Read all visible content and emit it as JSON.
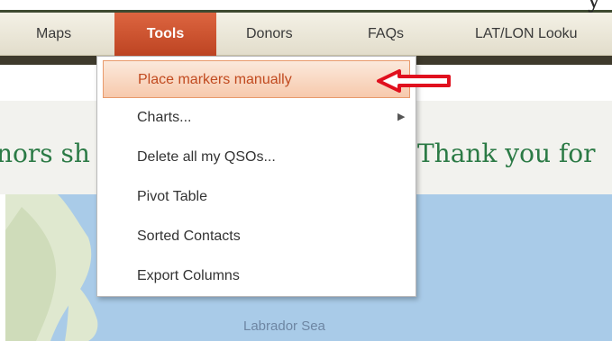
{
  "nav": {
    "items": [
      "Maps",
      "Tools",
      "Donors",
      "FAQs",
      "LAT/LON Looku"
    ],
    "active": "Tools"
  },
  "tools_menu": {
    "items": [
      {
        "label": "Place markers manually",
        "highlighted": true
      },
      {
        "label": "Charts...",
        "has_submenu": true
      },
      {
        "label": "Delete all my QSOs..."
      },
      {
        "label": "Pivot Table"
      },
      {
        "label": "Sorted Contacts"
      },
      {
        "label": "Export Columns"
      }
    ],
    "submenu_glyph": "▶"
  },
  "banner": {
    "left_fragment": "nors sh",
    "right_fragment": "Thank you for"
  },
  "map": {
    "label": "Labrador Sea"
  },
  "colors": {
    "accent": "#c9502c",
    "banner_text": "#2b7a45",
    "pointer_arrow": "#e0101e",
    "water": "#a9cbe8"
  },
  "icons": {
    "submenu": "chevron-right-icon",
    "annotation": "red-arrow-icon"
  }
}
